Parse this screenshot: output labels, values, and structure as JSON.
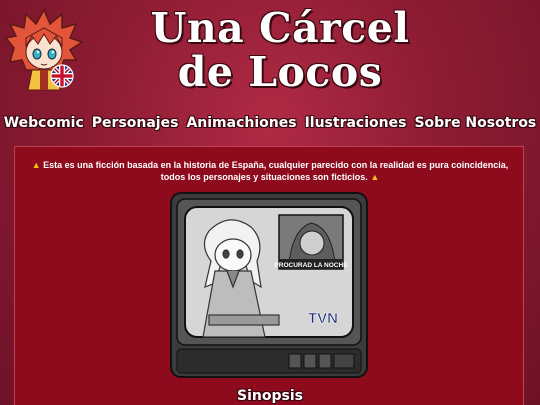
{
  "header": {
    "title_line1": "Una Cárcel",
    "title_line2": "de Locos",
    "language_flag_icon": "uk-flag-icon",
    "mascot": "mascot-character-icon"
  },
  "nav": {
    "items": [
      {
        "label": "Webcomic"
      },
      {
        "label": "Personajes"
      },
      {
        "label": "Animachiones"
      },
      {
        "label": "Ilustraciones"
      },
      {
        "label": "Sobre Nosotros"
      }
    ]
  },
  "main": {
    "notice_text": "Esta es una ficción basada en la historia de España, cualquier parecido con la realidad es pura coincidencia, todos los personajes y situaciones son ficticios.",
    "warning_symbol": "▲",
    "tv": {
      "inset_caption": "PROCURAD LA NOCHE",
      "channel_logo": "TVN"
    },
    "section_heading": "Sinopsis"
  },
  "colors": {
    "background": "#8d1c33",
    "panel": "#8e0a1d",
    "warning": "#f1c40f",
    "text": "#ffffff"
  }
}
